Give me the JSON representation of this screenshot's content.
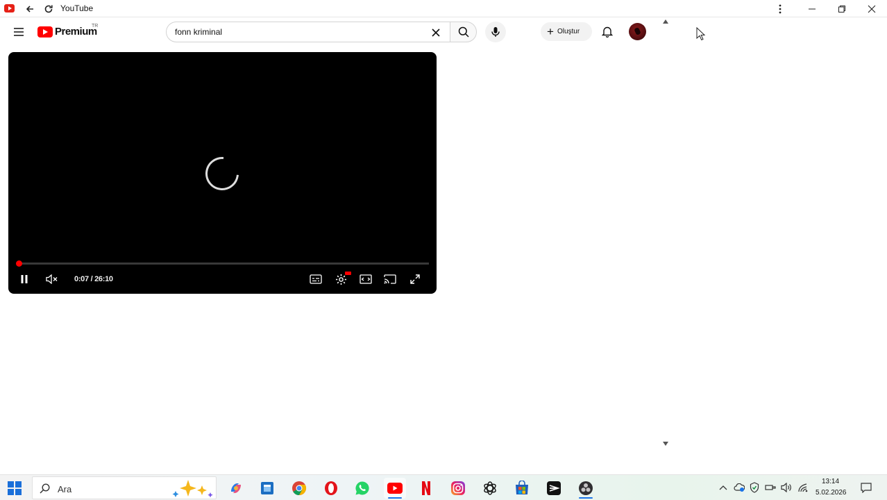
{
  "window": {
    "title": "YouTube"
  },
  "masthead": {
    "logo_text": "Premium",
    "logo_country": "TR",
    "search_value": "fonn kriminal",
    "create_label": "Oluştur"
  },
  "player": {
    "time_display": "0:07 / 26:10",
    "progress_fraction": 0.0045
  },
  "taskbar": {
    "search_placeholder": "Ara",
    "clock_time": "13:14",
    "clock_date": "5.02.2026",
    "apps": [
      "copilot-icon",
      "notes-icon",
      "chrome-icon",
      "opera-icon",
      "whatsapp-icon",
      "youtube-icon",
      "netflix-icon",
      "instagram-icon",
      "chatgpt-icon",
      "store-icon",
      "capcut-icon",
      "obs-icon"
    ]
  },
  "colors": {
    "youtube_red": "#ff0000",
    "player_bg": "#000000",
    "windows_blue": "#1a6fd9"
  }
}
